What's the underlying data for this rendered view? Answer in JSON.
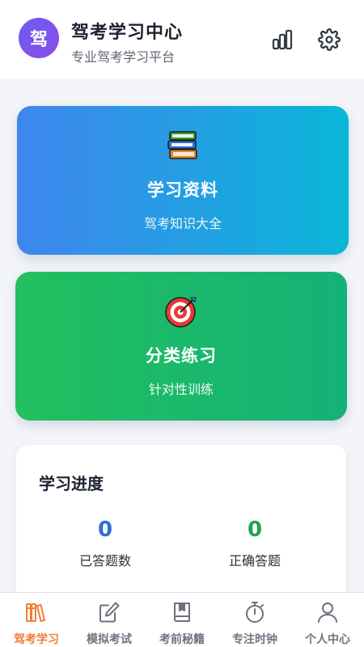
{
  "header": {
    "logo_text": "驾",
    "title": "驾考学习中心",
    "subtitle": "专业驾考学习平台",
    "stats_icon": "bar-chart-icon",
    "settings_icon": "gear-icon"
  },
  "cards": [
    {
      "icon": "books-icon",
      "title": "学习资料",
      "subtitle": "驾考知识大全"
    },
    {
      "icon": "target-icon",
      "title": "分类练习",
      "subtitle": "针对性训练"
    }
  ],
  "progress": {
    "title": "学习进度",
    "stats": [
      {
        "value": "0",
        "label": "已答题数"
      },
      {
        "value": "0",
        "label": "正确答题"
      }
    ]
  },
  "tabbar": {
    "items": [
      {
        "label": "驾考学习",
        "icon": "books-icon",
        "active": true
      },
      {
        "label": "模拟考试",
        "icon": "edit-icon"
      },
      {
        "label": "考前秘籍",
        "icon": "book-icon"
      },
      {
        "label": "专注时钟",
        "icon": "stopwatch-icon"
      },
      {
        "label": "个人中心",
        "icon": "user-icon"
      }
    ]
  },
  "colors": {
    "accent": "#f07d3a",
    "logo": "#7a55ec",
    "study_card": "#3f86ee",
    "practice_card": "#22c05e"
  }
}
